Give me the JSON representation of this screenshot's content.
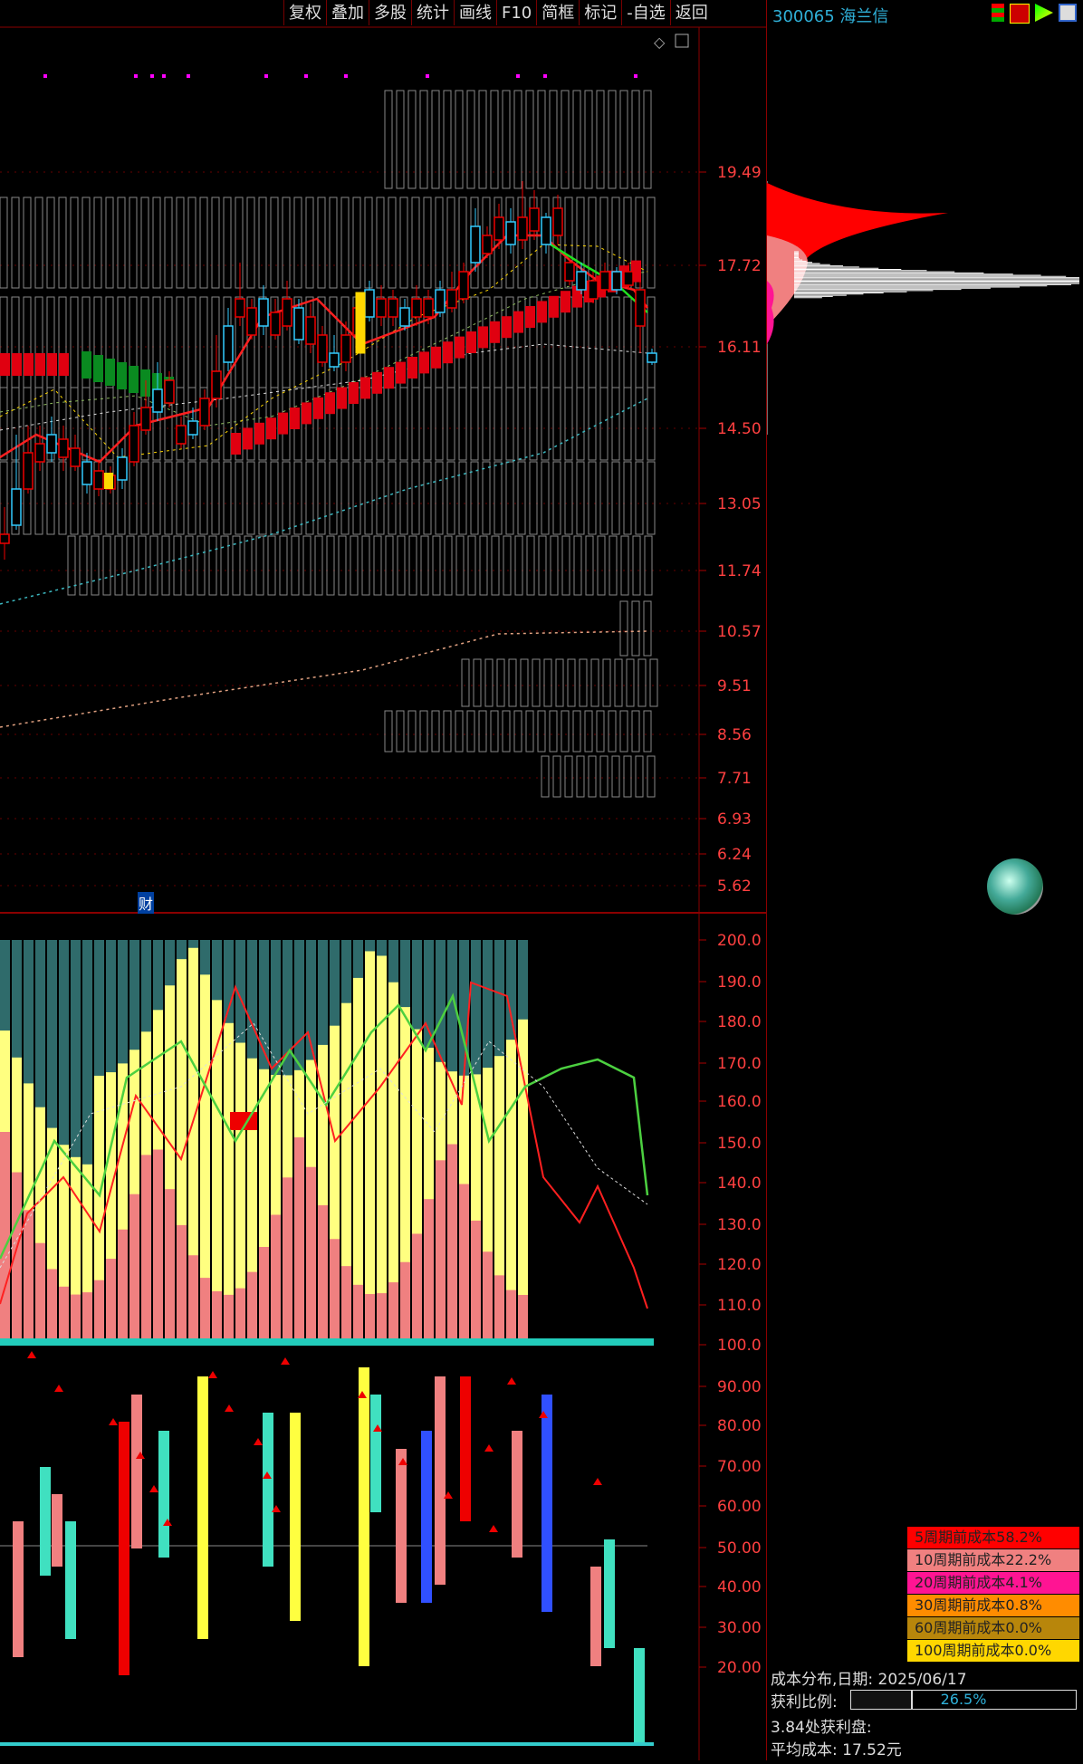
{
  "toolbar": {
    "buttons": [
      "复权",
      "叠加",
      "多股",
      "统计",
      "画线",
      "F10",
      "简框",
      "标记",
      "-自选",
      "返回"
    ]
  },
  "stock": {
    "code_name": "300065 海兰信"
  },
  "price_axis": [
    "19.49",
    "17.72",
    "16.11",
    "14.50",
    "13.05",
    "11.74",
    "10.57",
    "9.51",
    "8.56",
    "7.71",
    "6.93",
    "6.24",
    "5.62"
  ],
  "indicator_axis": [
    "200.0",
    "190.0",
    "180.0",
    "170.0",
    "160.0",
    "150.0",
    "140.0",
    "130.0",
    "120.0",
    "110.0",
    "100.0",
    "90.00",
    "80.00",
    "70.00",
    "60.00",
    "50.00",
    "40.00",
    "30.00",
    "20.00"
  ],
  "finance_marker": "财",
  "cost_legend": [
    {
      "label": "5周期前成本58.2%",
      "color": "#ff0000"
    },
    {
      "label": "10周期前成本22.2%",
      "color": "#f08080"
    },
    {
      "label": "20周期前成本4.1%",
      "color": "#ff1493"
    },
    {
      "label": "30周期前成本0.8%",
      "color": "#ff8c00"
    },
    {
      "label": "60周期前成本0.0%",
      "color": "#b8860b"
    },
    {
      "label": "100周期前成本0.0%",
      "color": "#ffd700"
    }
  ],
  "cost_info": {
    "date_line": "成本分布,日期: 2025/06/17",
    "profit_label": "获利比例:",
    "profit_value": "26.5%",
    "profit_ratio": 0.265,
    "profit_at_price": "3.84处获利盘:",
    "avg_cost": "平均成本: 17.52元"
  },
  "chart_data": {
    "type": "candlestick",
    "price_axis_ticks": [
      19.49,
      17.72,
      16.11,
      14.5,
      13.05,
      11.74,
      10.57,
      9.51,
      8.56,
      7.71,
      6.93,
      6.24,
      5.62
    ],
    "indicator_axis_ticks": [
      200,
      190,
      180,
      170,
      160,
      150,
      140,
      130,
      120,
      110,
      100,
      90,
      80,
      70,
      60,
      50,
      40,
      30,
      20
    ],
    "last_close_approx": 16.3
  }
}
